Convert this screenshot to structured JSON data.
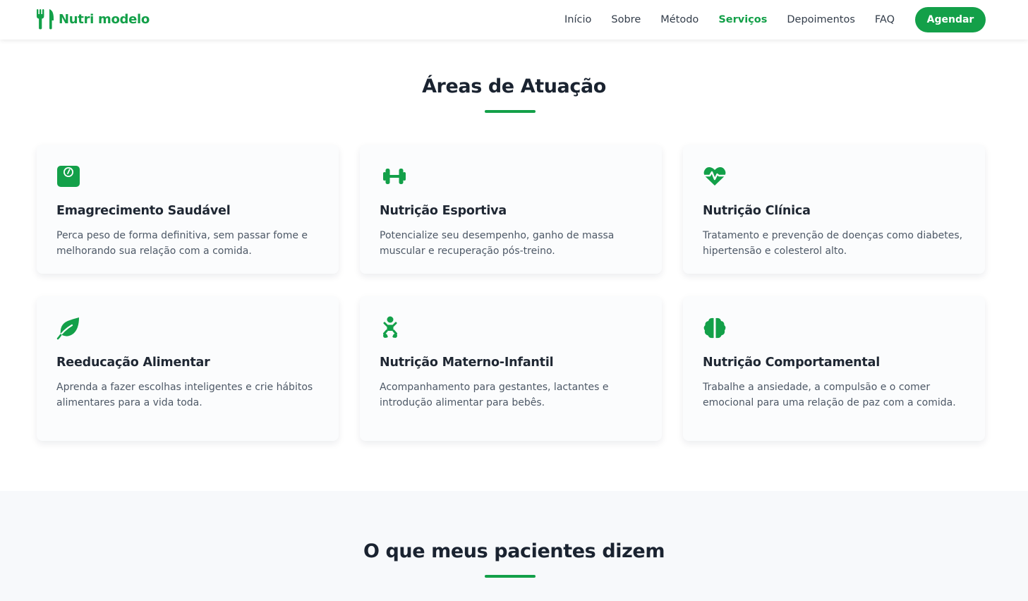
{
  "brand": {
    "name": "Nutri modelo",
    "color": "#13a049"
  },
  "nav": {
    "items": [
      {
        "label": "Início",
        "active": false
      },
      {
        "label": "Sobre",
        "active": false
      },
      {
        "label": "Método",
        "active": false
      },
      {
        "label": "Serviços",
        "active": true
      },
      {
        "label": "Depoimentos",
        "active": false
      },
      {
        "label": "FAQ",
        "active": false
      }
    ],
    "cta_label": "Agendar"
  },
  "areas": {
    "title": "Áreas de Atuação",
    "cards": [
      {
        "icon": "weight-scale-icon",
        "title": "Emagrecimento Saudável",
        "text": "Perca peso de forma definitiva, sem passar fome e melhorando sua relação com a comida."
      },
      {
        "icon": "dumbbell-icon",
        "title": "Nutrição Esportiva",
        "text": "Potencialize seu desempenho, ganho de massa muscular e recuperação pós-treino."
      },
      {
        "icon": "heart-pulse-icon",
        "title": "Nutrição Clínica",
        "text": "Tratamento e prevenção de doenças como diabetes, hipertensão e colesterol alto."
      },
      {
        "icon": "leaf-icon",
        "title": "Reeducação Alimentar",
        "text": "Aprenda a fazer escolhas inteligentes e crie hábitos alimentares para a vida toda."
      },
      {
        "icon": "baby-icon",
        "title": "Nutrição Materno-Infantil",
        "text": "Acompanhamento para gestantes, lactantes e introdução alimentar para bebês."
      },
      {
        "icon": "brain-icon",
        "title": "Nutrição Comportamental",
        "text": "Trabalhe a ansiedade, a compulsão e o comer emocional para uma relação de paz com a comida."
      }
    ]
  },
  "testimonials": {
    "title": "O que meus pacientes dizem"
  },
  "colors": {
    "accent": "#13a049",
    "heading": "#1a2330",
    "body_text": "#4d5866",
    "section_bg": "#f7f9fb"
  }
}
